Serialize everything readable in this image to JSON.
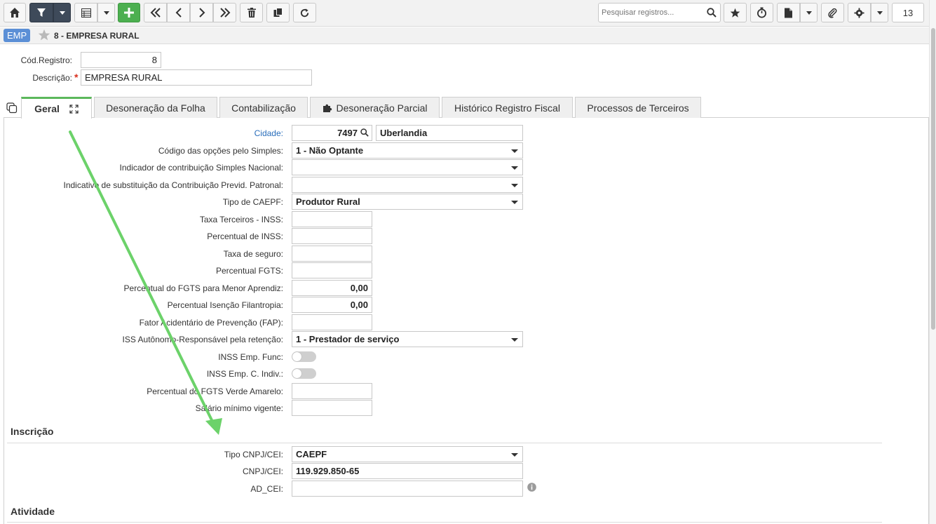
{
  "toolbar": {
    "search_placeholder": "Pesquisar registros...",
    "page_number": "13"
  },
  "header": {
    "badge": "EMP",
    "title": "8 - EMPRESA RURAL"
  },
  "record": {
    "cod_label": "Cód.Registro:",
    "cod_value": "8",
    "desc_label": "Descrição:",
    "desc_required": "*",
    "desc_value": "EMPRESA RURAL"
  },
  "tabs": [
    {
      "label": "Geral"
    },
    {
      "label": "Desoneração da Folha"
    },
    {
      "label": "Contabilização"
    },
    {
      "label": "Desoneração Parcial"
    },
    {
      "label": "Histórico Registro Fiscal"
    },
    {
      "label": "Processos de Terceiros"
    }
  ],
  "geral": {
    "cidade_label": "Cidade:",
    "cidade_code": "7497",
    "cidade_name": "Uberlandia",
    "simples_label": "Código das opções pelo Simples:",
    "simples_value": "1 - Não Optante",
    "ind_simples_label": "Indicador de contribuição Simples Nacional:",
    "ind_simples_value": "",
    "subst_label": "Indicativo de substituição da Contribuição Previd. Patronal:",
    "subst_value": "",
    "caepf_label": "Tipo de CAEPF:",
    "caepf_value": "Produtor Rural",
    "taxa_terceiros_label": "Taxa Terceiros - INSS:",
    "taxa_terceiros_value": "",
    "perc_inss_label": "Percentual de INSS:",
    "perc_inss_value": "",
    "taxa_seguro_label": "Taxa de seguro:",
    "taxa_seguro_value": "",
    "perc_fgts_label": "Percentual FGTS:",
    "perc_fgts_value": "",
    "perc_fgts_menor_label": "Percentual do FGTS para Menor Aprendiz:",
    "perc_fgts_menor_value": "0,00",
    "perc_isencao_label": "Percentual Isenção Filantropia:",
    "perc_isencao_value": "0,00",
    "fap_label": "Fator Acidentário de Prevenção (FAP):",
    "fap_value": "",
    "iss_label": "ISS Autônomo-Responsável pela retenção:",
    "iss_value": "1 - Prestador de serviço",
    "inss_func_label": "INSS Emp. Func:",
    "inss_indiv_label": "INSS Emp. C. Indiv.:",
    "fgts_verde_label": "Percentual do FGTS Verde Amarelo:",
    "fgts_verde_value": "",
    "salario_label": "Salário mínimo vigente:",
    "salario_value": ""
  },
  "inscricao": {
    "title": "Inscrição",
    "tipo_label": "Tipo CNPJ/CEI:",
    "tipo_value": "CAEPF",
    "cnpj_label": "CNPJ/CEI:",
    "cnpj_value": "119.929.850-65",
    "adcei_label": "AD_CEI:",
    "adcei_value": ""
  },
  "atividade": {
    "title": "Atividade"
  },
  "colors": {
    "accent_green": "#4caf50",
    "dark_button": "#3e4a5a",
    "badge_blue": "#5b8fd6",
    "annotation_arrow": "#6cd26a"
  }
}
